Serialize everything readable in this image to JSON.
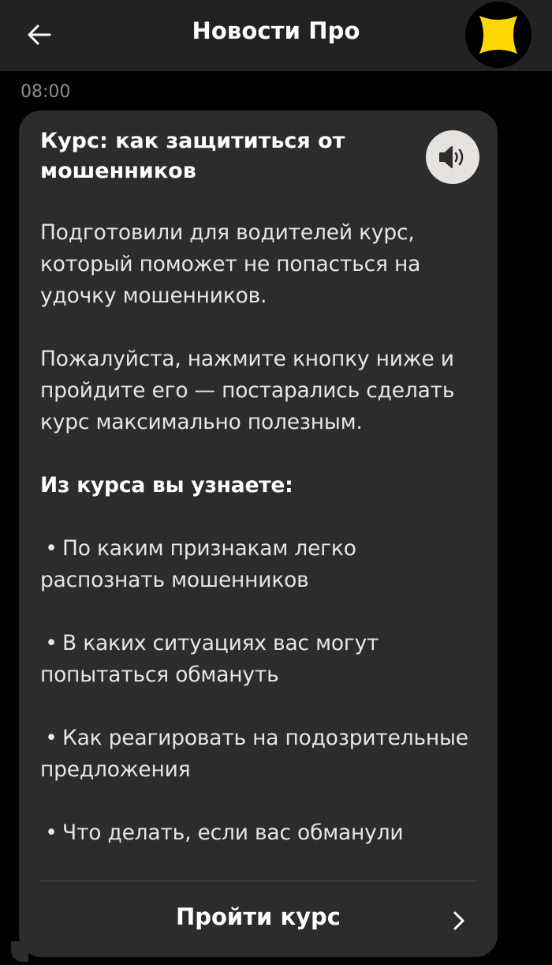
{
  "header": {
    "title": "Новости Про",
    "back_icon": "arrow-left-icon",
    "avatar_icon": "yandex-pro-logo",
    "accent_color": "#fcd700"
  },
  "message": {
    "time": "08:00",
    "title": "Курс: как защититься от мошенников",
    "audio_icon": "speaker-icon",
    "paragraphs": [
      "Подготовили для водителей курс, который поможет не попасться на удочку мошенников.",
      "Пожалуйста, нажмите кнопку ниже и пройдите его — постарались сделать курс максимально полезным."
    ],
    "subheading": "Из курса вы узнаете:",
    "bullets": [
      "По каким признакам легко распознать мошенников",
      "В каких ситуациях вас могут попытаться обмануть",
      "Как реагировать на подозрительные предложения",
      "Что делать, если вас обманули"
    ],
    "button_label": "Пройти курс",
    "button_icon": "chevron-right-icon"
  }
}
